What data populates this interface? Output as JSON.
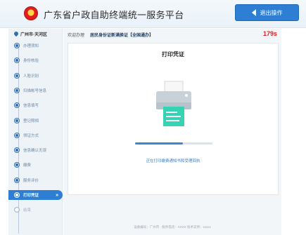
{
  "header": {
    "title": "广东省户政自助终端统一服务平台",
    "exit_label": "退出操作"
  },
  "sidebar": {
    "location": "广州市·天河区",
    "steps": [
      {
        "label": "办理须知",
        "state": "done"
      },
      {
        "label": "身份核验",
        "state": "done"
      },
      {
        "label": "人脸识别",
        "state": "done"
      },
      {
        "label": "扫描帐号信息",
        "state": "done"
      },
      {
        "label": "信息填写",
        "state": "done"
      },
      {
        "label": "登记照相",
        "state": "done"
      },
      {
        "label": "领证方式",
        "state": "done"
      },
      {
        "label": "信息确认无误",
        "state": "done"
      },
      {
        "label": "缴费",
        "state": "done"
      },
      {
        "label": "服务评价",
        "state": "done"
      },
      {
        "label": "打印凭证",
        "state": "active"
      },
      {
        "label": "结束",
        "state": "pending"
      }
    ]
  },
  "main": {
    "welcome_prefix": "欢迎办理",
    "business_name": "居民身份证新满换证【全国通办】",
    "countdown": "179s",
    "card_title": "打印凭证",
    "progress": 0.62,
    "status_text": "正在打印缴费通知书和受理回执",
    "footer": "设备编号：广州市 · 服务电话：XXXX 技术支持：xxxxx"
  },
  "colors": {
    "accent": "#2e7fd4",
    "countdown": "#e02020"
  }
}
